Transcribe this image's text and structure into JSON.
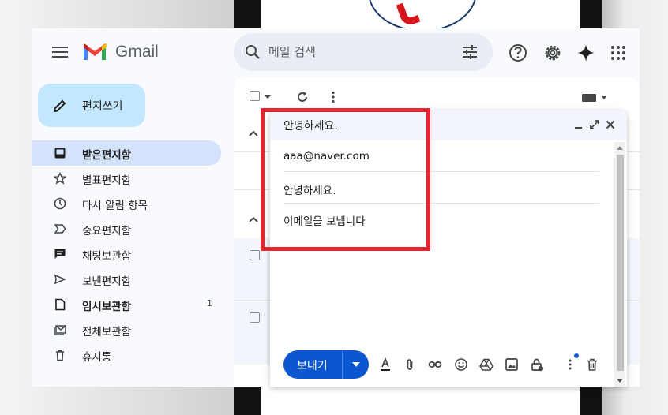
{
  "app": {
    "brand": "Gmail"
  },
  "search": {
    "placeholder": "메일 검색"
  },
  "sidebar": {
    "compose_label": "편지쓰기",
    "items": [
      {
        "label": "받은편지함",
        "icon": "inbox-icon",
        "active": true
      },
      {
        "label": "별표편지함",
        "icon": "star-icon"
      },
      {
        "label": "다시 알림 항목",
        "icon": "clock-icon"
      },
      {
        "label": "중요편지함",
        "icon": "important-icon"
      },
      {
        "label": "채팅보관함",
        "icon": "chat-icon"
      },
      {
        "label": "보낸편지함",
        "icon": "send-icon"
      },
      {
        "label": "임시보관함",
        "icon": "draft-icon",
        "bold": true,
        "count": "1"
      },
      {
        "label": "전체보관함",
        "icon": "all-mail-icon"
      },
      {
        "label": "휴지통",
        "icon": "trash-icon"
      }
    ]
  },
  "compose": {
    "title": "안녕하세요.",
    "to": "aaa@naver.com",
    "subject": "안녕하세요.",
    "body": "이메일을 보냅니다",
    "send_label": "보내기"
  },
  "colors": {
    "compose_button": "#c2e7ff",
    "active_nav": "#d3e3fd",
    "send_button": "#0b57d0",
    "highlight_box": "#e5252f"
  }
}
